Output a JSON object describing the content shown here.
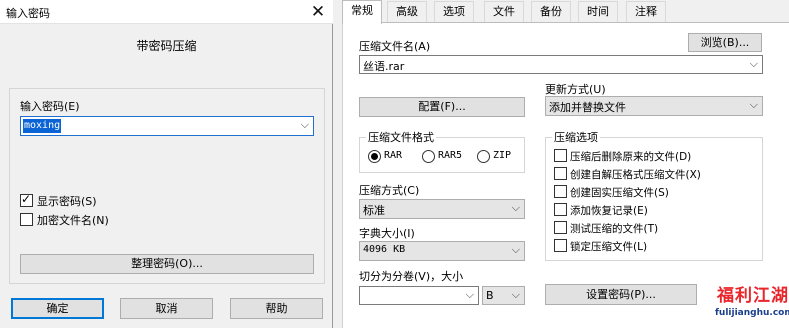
{
  "password_dialog": {
    "title": "输入密码",
    "heading": "带密码压缩",
    "password_label": "输入密码(E)",
    "password_value": "moxing",
    "show_password": {
      "label": "显示密码(S)",
      "checked": true
    },
    "encrypt_file_names": {
      "label": "加密文件名(N)",
      "checked": false
    },
    "organize_button": "整理密码(O)...",
    "ok_button": "确定",
    "cancel_button": "取消",
    "help_button": "帮助"
  },
  "archive_dialog": {
    "tabs": [
      {
        "label": "常规",
        "active": true
      },
      {
        "label": "高级",
        "active": false
      },
      {
        "label": "选项",
        "active": false
      },
      {
        "label": "文件",
        "active": false
      },
      {
        "label": "备份",
        "active": false
      },
      {
        "label": "时间",
        "active": false
      },
      {
        "label": "注释",
        "active": false
      }
    ],
    "archive_name_label": "压缩文件名(A)",
    "browse_button": "浏览(B)...",
    "archive_name_value": "丝语.rar",
    "profiles_button": "配置(F)...",
    "update_mode_label": "更新方式(U)",
    "update_mode_value": "添加并替换文件",
    "archive_format": {
      "label": "压缩文件格式",
      "options": [
        {
          "label": "RAR",
          "selected": true
        },
        {
          "label": "RAR5",
          "selected": false
        },
        {
          "label": "ZIP",
          "selected": false
        }
      ]
    },
    "compression_method_label": "压缩方式(C)",
    "compression_method_value": "标准",
    "dictionary_size_label": "字典大小(I)",
    "dictionary_size_value": "4096 KB",
    "split_label": "切分为分卷(V)，大小",
    "split_value": "",
    "split_unit": "B",
    "archiving_options": {
      "label": "压缩选项",
      "items": [
        {
          "label": "压缩后删除原来的文件(D)",
          "checked": false
        },
        {
          "label": "创建自解压格式压缩文件(X)",
          "checked": false
        },
        {
          "label": "创建固实压缩文件(S)",
          "checked": false
        },
        {
          "label": "添加恢复记录(E)",
          "checked": false
        },
        {
          "label": "测试压缩的文件(T)",
          "checked": false
        },
        {
          "label": "锁定压缩文件(L)",
          "checked": false
        }
      ]
    },
    "set_password_button": "设置密码(P)..."
  },
  "watermark": {
    "text": "福利江湖",
    "url": "fulijianghu.com"
  }
}
